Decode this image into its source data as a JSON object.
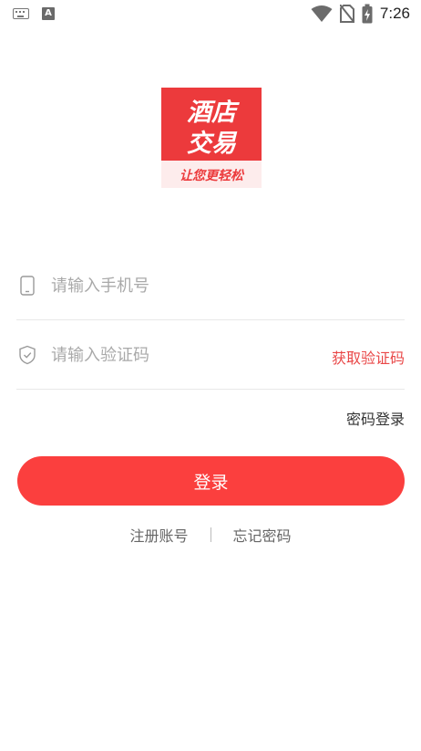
{
  "status_bar": {
    "time": "7:26",
    "icons": [
      "keyboard-icon",
      "a-notification-icon",
      "wifi-icon",
      "no-sim-icon",
      "battery-charging-icon"
    ]
  },
  "logo": {
    "line1": "酒店",
    "line2": "交易",
    "tagline": "让您更轻松",
    "brand_color": "#ec3a3c"
  },
  "form": {
    "phone_placeholder": "请输入手机号",
    "phone_value": "",
    "code_placeholder": "请输入验证码",
    "code_value": "",
    "get_code_label": "获取验证码",
    "password_login_label": "密码登录"
  },
  "login_button": {
    "label": "登录",
    "color": "#fb3f3e"
  },
  "links": {
    "register": "注册账号",
    "forgot_password": "忘记密码"
  }
}
